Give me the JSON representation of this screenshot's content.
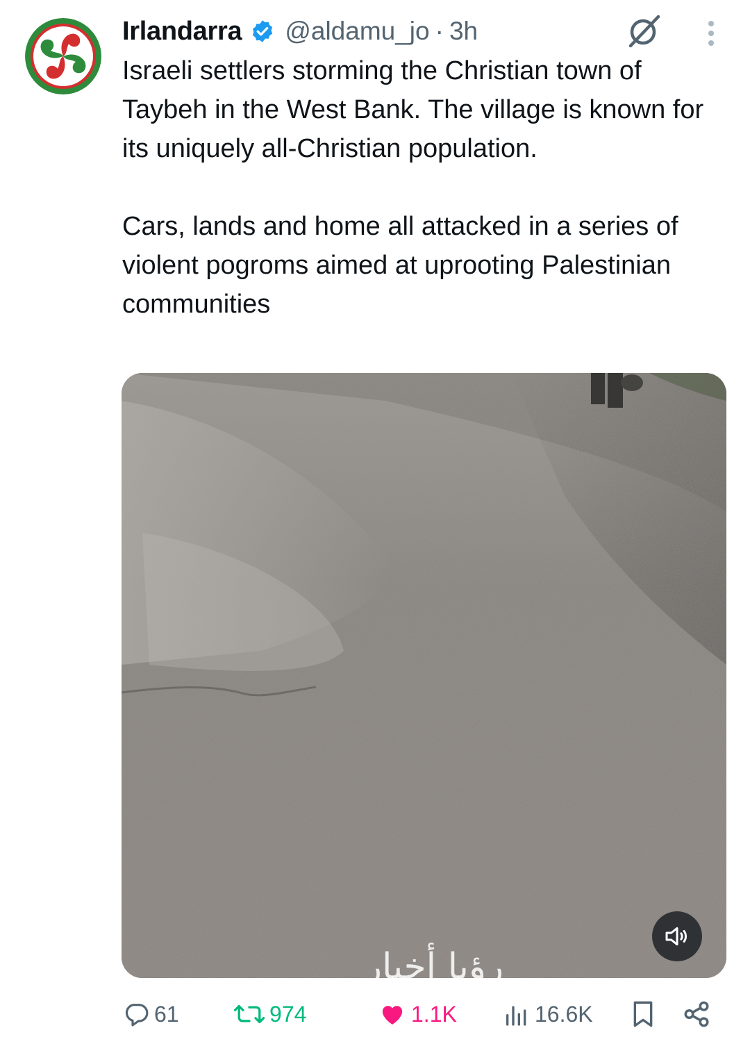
{
  "tweet": {
    "author": {
      "display_name": "Irlandarra",
      "verified": true,
      "handle": "@aldamu_jo",
      "separator": "·",
      "time": "3h"
    },
    "text_paragraphs": [
      "Israeli settlers storming the Christian town of Taybeh in the West Bank. The village is known for its uniquely all-Christian population.",
      "Cars, lands and home all attacked in a series of violent pogroms aimed at uprooting Palestinian communities"
    ],
    "media": {
      "type": "video",
      "overlay_caption": "رؤيا أخبار",
      "muted_icon": "volume-icon"
    },
    "stats": {
      "replies": "61",
      "reposts": "974",
      "likes": "1.1K",
      "views": "16.6K"
    },
    "icons": {
      "reply": "reply-icon",
      "repost": "repost-icon",
      "like": "heart-icon",
      "views": "views-icon",
      "bookmark": "bookmark-icon",
      "share": "share-icon",
      "grok": "grok-icon",
      "more": "more-icon",
      "verified": "verified-badge-icon"
    },
    "colors": {
      "verified": "#1d9bf0",
      "repost_active": "#00ba7c",
      "like_active": "#f91880",
      "muted_text": "#536471",
      "text": "#0f1419"
    }
  }
}
